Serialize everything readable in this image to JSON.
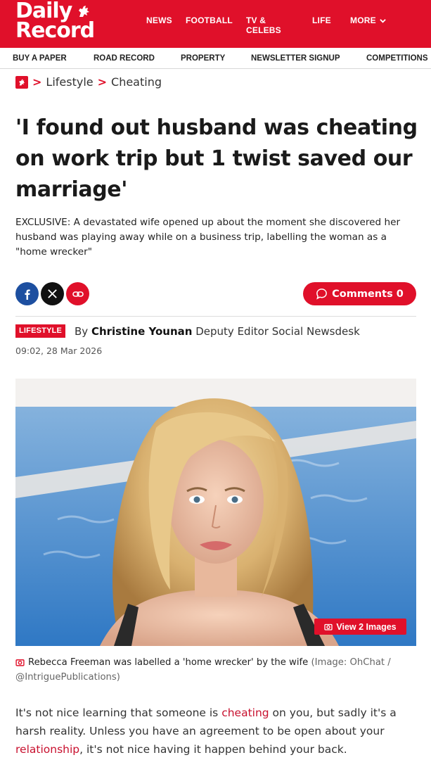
{
  "brand": {
    "line1": "Daily",
    "line2": "Record",
    "color": "#e0102a"
  },
  "topnav": {
    "items": [
      "NEWS",
      "FOOTBALL",
      "TV & CELEBS",
      "LIFE"
    ],
    "more_label": "MORE"
  },
  "subnav": {
    "items": [
      "BUY A PAPER",
      "ROAD RECORD",
      "PROPERTY",
      "NEWSLETTER SIGNUP",
      "COMPETITIONS"
    ]
  },
  "breadcrumb": {
    "items": [
      "Lifestyle",
      "Cheating"
    ]
  },
  "article": {
    "headline": "'I found out husband was cheating on work trip but 1 twist saved our marriage'",
    "standfirst": "EXCLUSIVE: A devastated wife opened up about the moment she discovered her husband was playing away while on a business trip, labelling the woman as a \"home wrecker\"",
    "comments_label": "Comments 0",
    "category_tag": "LIFESTYLE",
    "byline_prefix": "By",
    "author": "Christine Younan",
    "author_role": "Deputy Editor Social Newsdesk",
    "date": "09:02, 28 Mar 2026",
    "view_images_label": "View 2 Images",
    "caption_text": "Rebecca Freeman was labelled a 'home wrecker' by the wife",
    "caption_credit": "(Image: OhChat / @IntriguePublications)",
    "body": {
      "p1_before": "It's not nice learning that someone is ",
      "p1_link1": "cheating",
      "p1_mid": " on you, but sadly it's a harsh reality. Unless you have an agreement to be open about your ",
      "p1_link2": "relationship",
      "p1_after": ", it's not nice having it happen behind your back."
    }
  },
  "icons": {
    "share": [
      "facebook-icon",
      "x-icon",
      "link-icon"
    ],
    "comments": "comment-bubble-icon",
    "camera": "camera-icon",
    "logo_mark": "lion-rampant-icon",
    "chevron": "chevron-down-icon"
  }
}
